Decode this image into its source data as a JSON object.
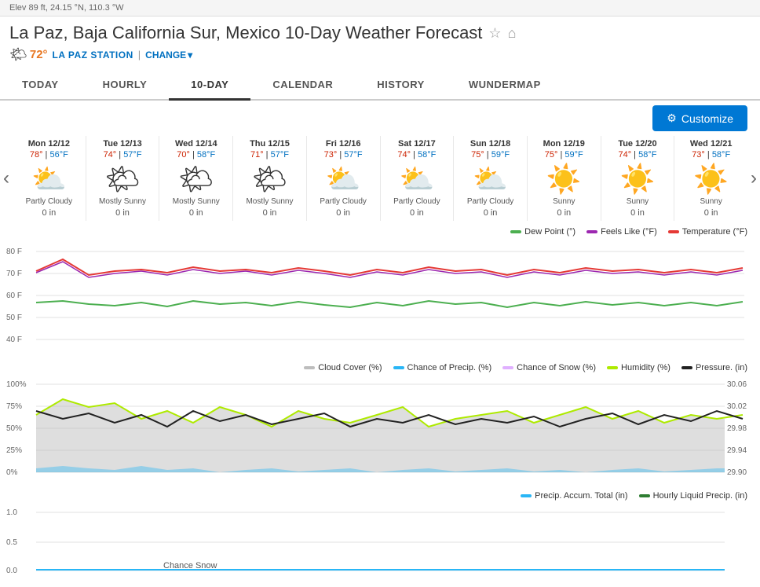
{
  "elevation": "Elev 89 ft, 24.15 °N, 110.3 °W",
  "page_title": "La Paz, Baja California Sur, Mexico 10-Day Weather Forecast",
  "current_temp": "72°",
  "station": "LA PAZ STATION",
  "change_label": "CHANGE",
  "tabs": [
    {
      "id": "today",
      "label": "TODAY"
    },
    {
      "id": "hourly",
      "label": "HOURLY"
    },
    {
      "id": "10day",
      "label": "10-DAY",
      "active": true
    },
    {
      "id": "calendar",
      "label": "CALENDAR"
    },
    {
      "id": "history",
      "label": "HISTORY"
    },
    {
      "id": "wundermap",
      "label": "WUNDERMAP"
    }
  ],
  "customize_label": "Customize",
  "days": [
    {
      "date": "Mon 12/12",
      "high": "78°",
      "low": "56°F",
      "condition": "Partly Cloudy",
      "icon": "⛅",
      "precip": "0 in"
    },
    {
      "date": "Tue 12/13",
      "high": "74°",
      "low": "57°F",
      "condition": "Mostly Sunny",
      "icon": "🌤",
      "precip": "0 in"
    },
    {
      "date": "Wed 12/14",
      "high": "70°",
      "low": "58°F",
      "condition": "Mostly Sunny",
      "icon": "🌤",
      "precip": "0 in"
    },
    {
      "date": "Thu 12/15",
      "high": "71°",
      "low": "57°F",
      "condition": "Mostly Sunny",
      "icon": "🌤",
      "precip": "0 in"
    },
    {
      "date": "Fri 12/16",
      "high": "73°",
      "low": "57°F",
      "condition": "Partly Cloudy",
      "icon": "⛅",
      "precip": "0 in"
    },
    {
      "date": "Sat 12/17",
      "high": "74°",
      "low": "58°F",
      "condition": "Partly Cloudy",
      "icon": "⛅",
      "precip": "0 in"
    },
    {
      "date": "Sun 12/18",
      "high": "75°",
      "low": "59°F",
      "condition": "Partly Cloudy",
      "icon": "⛅",
      "precip": "0 in"
    },
    {
      "date": "Mon 12/19",
      "high": "75°",
      "low": "59°F",
      "condition": "Sunny",
      "icon": "☀️",
      "precip": "0 in"
    },
    {
      "date": "Tue 12/20",
      "high": "74°",
      "low": "58°F",
      "condition": "Sunny",
      "icon": "☀️",
      "precip": "0 in"
    },
    {
      "date": "Wed 12/21",
      "high": "73°",
      "low": "58°F",
      "condition": "Sunny",
      "icon": "☀️",
      "precip": "0 in"
    }
  ],
  "chart1_legend": [
    {
      "label": "Dew Point (°)",
      "color": "#4caf50"
    },
    {
      "label": "Feels Like (°F)",
      "color": "#9c27b0"
    },
    {
      "label": "Temperature (°F)",
      "color": "#e53935"
    }
  ],
  "chart2_legend": [
    {
      "label": "Cloud Cover (%)",
      "color": "#bdbdbd"
    },
    {
      "label": "Chance of Precip. (%)",
      "color": "#29b6f6"
    },
    {
      "label": "Chance of Snow (%)",
      "color": "#e0b0ff"
    },
    {
      "label": "Humidity (%)",
      "color": "#aeea00"
    },
    {
      "label": "Pressure. (in)",
      "color": "#212121"
    }
  ],
  "chart3_legend": [
    {
      "label": "Precip. Accum. Total (in)",
      "color": "#29b6f6"
    },
    {
      "label": "Hourly Liquid Precip. (in)",
      "color": "#2e7d32"
    }
  ],
  "y_axis_temp": [
    "80 F",
    "70 F",
    "60 F",
    "50 F",
    "40 F"
  ],
  "y_axis_pct": [
    "100%",
    "75%",
    "50%",
    "25%",
    "0%"
  ],
  "y_axis_right": [
    "30.06",
    "30.02",
    "29.98",
    "29.94",
    "29.90"
  ],
  "y_axis_precip": [
    "1.0",
    "0.5",
    "0.0"
  ]
}
